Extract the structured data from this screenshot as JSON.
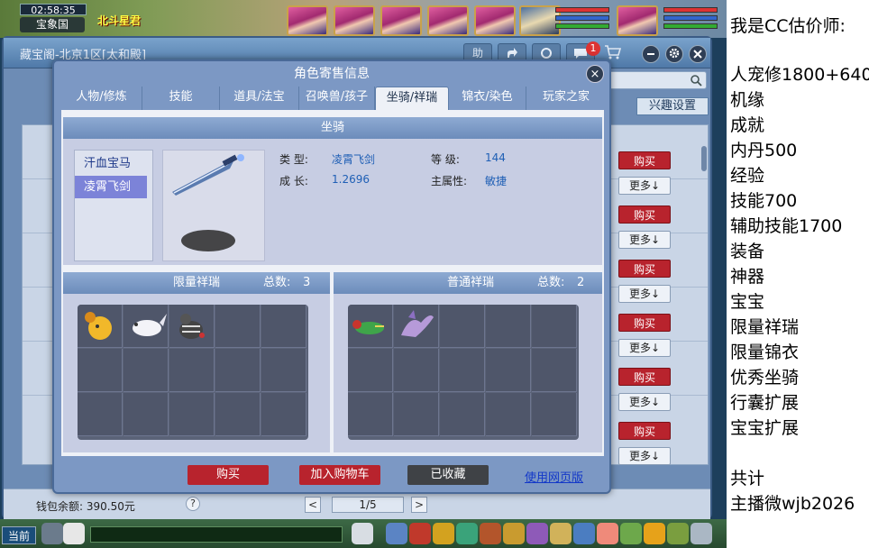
{
  "game": {
    "clock": "02:58:35",
    "location": "宝象国",
    "top_status": "北斗星君"
  },
  "shop": {
    "title": "藏宝阁-北京1区[太和殿]",
    "help_label": "助",
    "notification_count": "1",
    "interest_button": "兴趣设置",
    "buy_label": "购买",
    "more_label": "更多↓",
    "wallet": "钱包余额: 390.50元",
    "help_mark": "?",
    "page": "1/5",
    "prev": "<",
    "next": ">"
  },
  "modal": {
    "title": "角色寄售信息",
    "close": "×",
    "tabs": [
      {
        "label": "人物/修炼"
      },
      {
        "label": "技能"
      },
      {
        "label": "道具/法宝"
      },
      {
        "label": "召唤兽/孩子"
      },
      {
        "label": "坐骑/祥瑞"
      },
      {
        "label": "锦衣/染色"
      },
      {
        "label": "玩家之家"
      }
    ],
    "active_tab": "坐骑/祥瑞",
    "mount_section": "坐骑",
    "mounts": [
      {
        "name": "汗血宝马"
      },
      {
        "name": "凌霄飞剑"
      }
    ],
    "selected_mount": "凌霄飞剑",
    "mount_info": {
      "type_label": "类 型:",
      "type_value": "凌霄飞剑",
      "level_label": "等 级:",
      "level_value": "144",
      "growth_label": "成 长:",
      "growth_value": "1.2696",
      "attr_label": "主属性:",
      "attr_value": "敏捷"
    },
    "limited_xiangrui": {
      "title": "限量祥瑞",
      "total_label": "总数:",
      "total": "3"
    },
    "normal_xiangrui": {
      "title": "普通祥瑞",
      "total_label": "总数:",
      "total": "2"
    },
    "buttons": {
      "buy": "购买",
      "add_cart": "加入购物车",
      "favorited": "已收藏",
      "web": "使用网页版"
    }
  },
  "bottom": {
    "chat_channel": "当前"
  },
  "right_panel": {
    "lines": [
      "我是CC估价师:",
      "人宠修1800+640",
      "机缘",
      "成就",
      "内丹500",
      "经验",
      "技能700",
      "辅助技能1700",
      "装备",
      "神器",
      "宝宝",
      "限量祥瑞",
      "限量锦衣",
      "优秀坐骑",
      "行囊扩展",
      "宝宝扩展",
      "",
      "共计",
      "主播微wjb2026"
    ]
  },
  "colors": {
    "buy_red": "#b8232d",
    "selected_item": "#7c83d8",
    "link_blue": "#1338c8",
    "value_blue": "#1f5fb5"
  }
}
